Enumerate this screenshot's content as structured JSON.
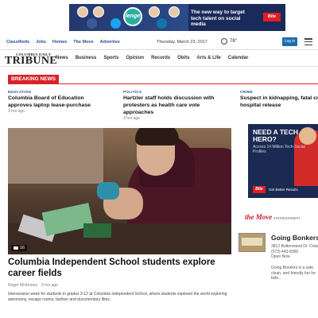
{
  "top_ad": {
    "logo": "lenge",
    "message": "The new way to target tech talent on social media",
    "button": "Bite"
  },
  "utility": {
    "links": [
      "Classifieds",
      "Jobs",
      "Homes",
      "The Move",
      "Advertise"
    ],
    "date": "Thursday, March 23, 2017",
    "temperature": "78°",
    "login": "Log in"
  },
  "masthead": {
    "small": "COLUMBIA DAILY",
    "big": "TRIBUNE",
    "sections": [
      "News",
      "Business",
      "Sports",
      "Opinion",
      "Records",
      "Obits",
      "Arts & Life",
      "Calendar"
    ]
  },
  "breaking": {
    "label": "BREAKING NEWS",
    "items": [
      {
        "category": "EDUCATION",
        "title": "Columbia Board of Education approves laptop lease-purchase",
        "meta": "3 hrs ago"
      },
      {
        "category": "POLITICS",
        "title": "Hartzler staff holds discussion with protesters as health care vote approaches",
        "meta": "3 hrs ago"
      },
      {
        "category": "CRIME",
        "title": "Suspect in kidnapping, fatal crash after hospital release",
        "meta": "3 hrs ago"
      }
    ]
  },
  "main_story": {
    "photo_count": "16",
    "title": "Columbia Independent School students explore career fields",
    "author": "Roger McKinney",
    "time": "9 hrs ago",
    "blurb": "Intersession week for students in grades 3-12 at Columbia Independent School, where students explored the world exploring astronomy, escape rooms, fashion and documentary films."
  },
  "side_ad": {
    "headline": "NEED A TECH HERO?",
    "sub": "Access 14 Million Tech-Social Profiles",
    "button": "Bite",
    "footer": "Get Better Results"
  },
  "move": {
    "logo": "the Move",
    "tag": "ENTERTAINMENT"
  },
  "business": {
    "name": "Going Bonkers",
    "address": [
      "3812 Buttonwood Dr. Columbia",
      "(573) 442-8366",
      "Open Now"
    ],
    "description": "Going Bonkers is a safe, clean, and friendly fun for kids..."
  }
}
